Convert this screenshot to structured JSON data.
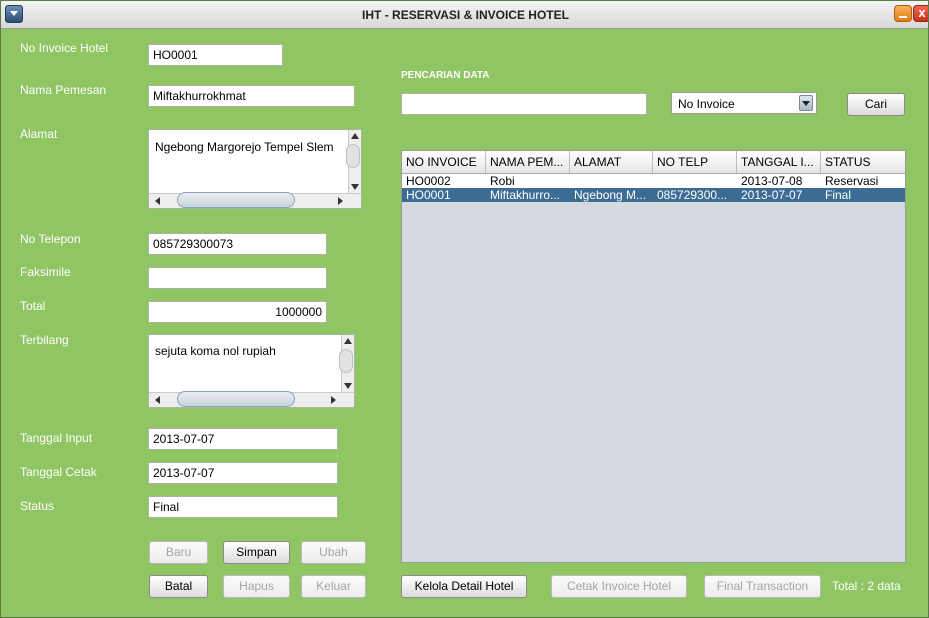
{
  "window": {
    "title": "IHT - RESERVASI & INVOICE HOTEL",
    "close_glyph": "x",
    "background": "#8fc563"
  },
  "form": {
    "invoice_label": "No Invoice Hotel",
    "invoice_value": "HO0001",
    "name_label": "Nama Pemesan",
    "name_value": "Miftakhurrokhmat",
    "address_label": "Alamat",
    "address_value": "Ngebong Margorejo Tempel Slem",
    "phone_label": "No Telepon",
    "phone_value": "085729300073",
    "fax_label": "Faksimile",
    "fax_value": "",
    "total_label": "Total",
    "total_value": "1000000",
    "spelled_label": "Terbilang",
    "spelled_value": "sejuta koma nol rupiah",
    "input_date_label": "Tanggal Input",
    "input_date_value": "2013-07-07",
    "print_date_label": "Tanggal Cetak",
    "print_date_value": "2013-07-07",
    "status_label": "Status",
    "status_value": "Final"
  },
  "buttons": {
    "new": "Baru",
    "save": "Simpan",
    "edit": "Ubah",
    "cancel": "Batal",
    "delete": "Hapus",
    "exit": "Keluar",
    "manage_detail": "Kelola Detail Hotel",
    "print_invoice": "Cetak Invoice Hotel",
    "final_transaction": "Final Transaction",
    "search": "Cari"
  },
  "search": {
    "section_title": "PENCARIAN DATA",
    "query": "",
    "filter_selected": "No Invoice"
  },
  "table": {
    "columns": [
      "NO INVOICE",
      "NAMA PEM...",
      "ALAMAT",
      "NO TELP",
      "TANGGAL I...",
      "STATUS"
    ],
    "rows": [
      [
        "HO0002",
        "Robi",
        "",
        "",
        "2013-07-08",
        "Reservasi"
      ],
      [
        "HO0001",
        "Miftakhurro...",
        "Ngebong M...",
        "085729300...",
        "2013-07-07",
        "Final"
      ]
    ],
    "selected_row": 1
  },
  "footer": {
    "total_text": "Total : 2 data"
  }
}
